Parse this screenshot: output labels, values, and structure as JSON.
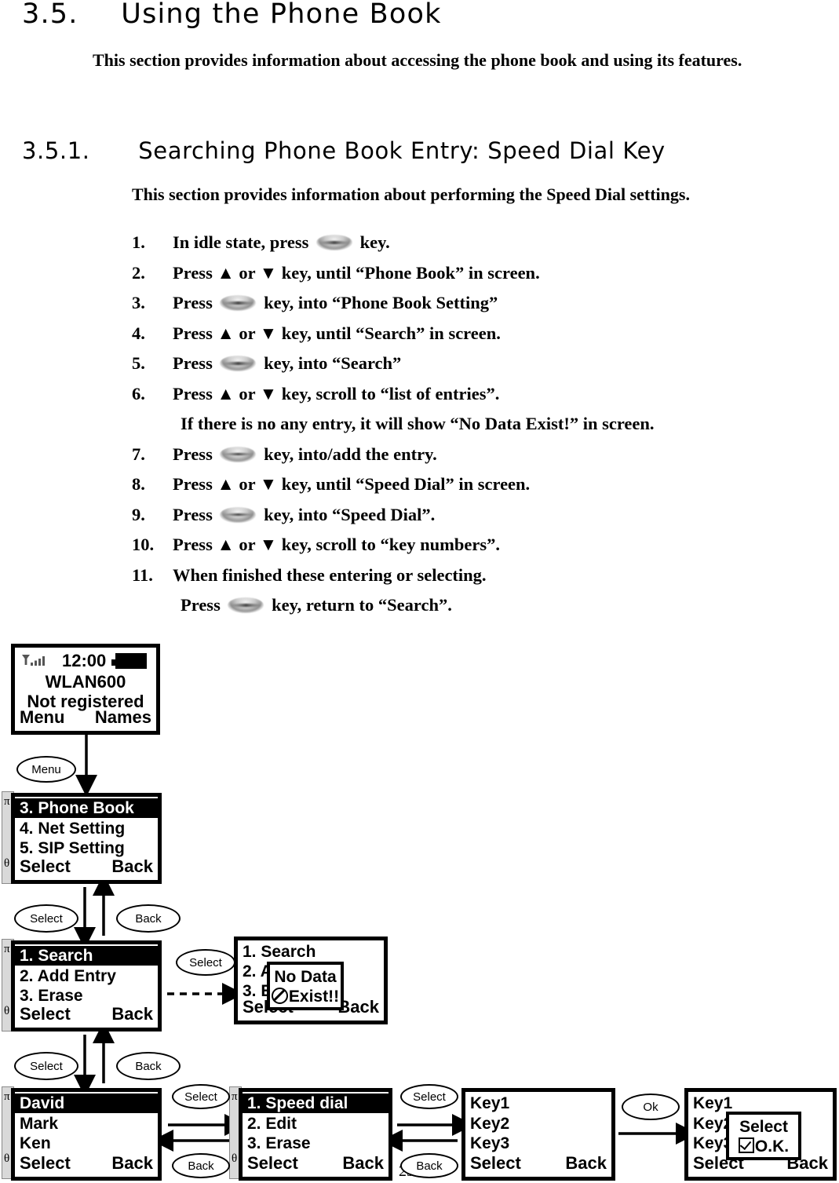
{
  "document": {
    "section_number": "3.5.",
    "section_title": "Using the Phone Book",
    "section_intro": "This section provides information about accessing the phone book and using its features.",
    "subsection_number": "3.5.1.",
    "subsection_title": "Searching Phone Book Entry: Speed Dial Key",
    "subsection_intro": "This section provides information about performing the Speed Dial settings.",
    "page_number": "29"
  },
  "steps": [
    {
      "idx": "1.",
      "before": "In idle state, press",
      "icon": "ok-key-icon",
      "after": "key."
    },
    {
      "idx": "2.",
      "before": "Press ▲ or ▼ key, until “Phone Book” in screen.",
      "icon": "",
      "after": ""
    },
    {
      "idx": "3.",
      "before": "Press",
      "icon": "ok-key-icon",
      "after": "key, into “Phone Book Setting”"
    },
    {
      "idx": "4.",
      "before": "Press ▲ or ▼ key, until “Search” in screen.",
      "icon": "",
      "after": ""
    },
    {
      "idx": "5.",
      "before": "Press",
      "icon": "ok-key-icon",
      "after": "key, into “Search”"
    },
    {
      "idx": "6.",
      "before": "Press ▲  or ▼  key, scroll to “list of entries”.",
      "icon": "",
      "after": ""
    },
    {
      "idx": "",
      "sub": "If there is no any entry, it will show “No Data Exist!” in screen."
    },
    {
      "idx": "7.",
      "before": "Press",
      "icon": "ok-key-icon",
      "after": "key, into/add the entry."
    },
    {
      "idx": "8.",
      "before": "Press ▲ or ▼ key, until “Speed Dial” in screen.",
      "icon": "",
      "after": ""
    },
    {
      "idx": "9.",
      "before": "Press",
      "icon": "ok-key-icon",
      "after": "key, into “Speed Dial”."
    },
    {
      "idx": "10.",
      "before": "Press ▲  or ▼  key, scroll to “key numbers”.",
      "icon": "",
      "after": ""
    },
    {
      "idx": "11.",
      "before": "When finished these entering or selecting.",
      "icon": "",
      "after": ""
    },
    {
      "idx": "",
      "before2": "Press",
      "icon": "ok-key-icon",
      "after2": "key, return to “Search”."
    }
  ],
  "diagram": {
    "screens": {
      "idle": {
        "name": "idle-screen",
        "clock": "12:00",
        "signal_icon": "signal-bars-icon",
        "battery_icon": "battery-full-icon",
        "line1": "WLAN600",
        "line2": "Not registered",
        "softkey_left": "Menu",
        "softkey_right": "Names"
      },
      "main_menu": {
        "name": "main-menu-screen",
        "items": [
          "3. Phone Book",
          "4. Net Setting",
          "5. SIP Setting"
        ],
        "highlighted": 0,
        "softkey_left": "Select",
        "softkey_right": "Back",
        "scroll_up": "π",
        "scroll_down": "θ"
      },
      "phonebook_menu": {
        "name": "phonebook-menu-screen",
        "items": [
          "1. Search",
          "2. Add Entry",
          "3. Erase"
        ],
        "highlighted": 0,
        "softkey_left": "Select",
        "softkey_right": "Back",
        "scroll_up": "π",
        "scroll_down": "θ"
      },
      "nodata": {
        "name": "no-data-screen",
        "items": [
          "1. Search",
          "2. A",
          "3. E"
        ],
        "softkey_left": "Select",
        "softkey_right": "Back",
        "popup_line1": "No Data",
        "popup_line2": "Exist!!",
        "popup_icon": "prohibited-icon"
      },
      "entries": {
        "name": "entry-list-screen",
        "items": [
          "David",
          "Mark",
          "Ken"
        ],
        "highlighted": 0,
        "softkey_left": "Select",
        "softkey_right": "Back",
        "scroll_up": "π",
        "scroll_down": "θ"
      },
      "entry_menu": {
        "name": "entry-options-screen",
        "items": [
          "1. Speed dial",
          "2. Edit",
          "3. Erase"
        ],
        "highlighted": 0,
        "softkey_left": "Select",
        "softkey_right": "Back",
        "scroll_up": "π",
        "scroll_down": "θ"
      },
      "keys": {
        "name": "speed-dial-keys-screen",
        "items": [
          "Key1",
          "Key2",
          "Key3"
        ],
        "softkey_left": "Select",
        "softkey_right": "Back"
      },
      "keys_ok": {
        "name": "speed-dial-confirm-screen",
        "items": [
          "Key1",
          "Key2",
          "Key3"
        ],
        "softkey_left": "Select",
        "softkey_right": "Back",
        "popup_line1": "Select",
        "popup_line2": "O.K.",
        "popup_icon": "checkbox-checked-icon"
      }
    },
    "labels": {
      "menu": "Menu",
      "select": "Select",
      "back": "Back",
      "ok": "Ok"
    }
  }
}
